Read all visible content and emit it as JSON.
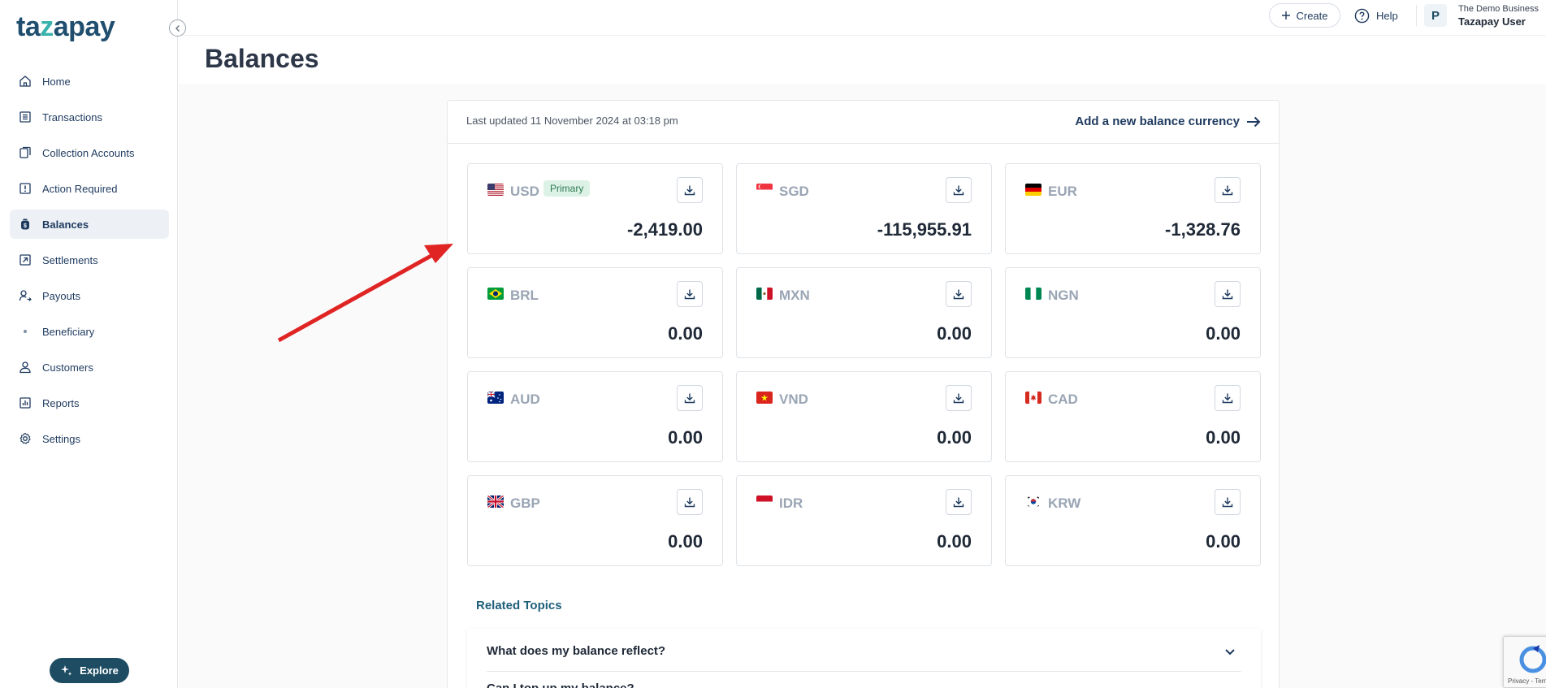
{
  "app": {
    "logo_pre": "ta",
    "logo_z": "z",
    "logo_post": "apay"
  },
  "sidebar": {
    "items": [
      {
        "label": "Home",
        "icon": "home-icon"
      },
      {
        "label": "Transactions",
        "icon": "list-icon"
      },
      {
        "label": "Collection Accounts",
        "icon": "accounts-icon"
      },
      {
        "label": "Action Required",
        "icon": "alert-icon"
      },
      {
        "label": "Balances",
        "icon": "wallet-icon",
        "active": true
      },
      {
        "label": "Settlements",
        "icon": "settlement-icon"
      },
      {
        "label": "Payouts",
        "icon": "payout-icon"
      },
      {
        "label": "Beneficiary",
        "icon": "dot-icon",
        "sub": true
      },
      {
        "label": "Customers",
        "icon": "user-icon"
      },
      {
        "label": "Reports",
        "icon": "chart-icon"
      },
      {
        "label": "Settings",
        "icon": "gear-icon"
      }
    ],
    "explore_label": "Explore"
  },
  "topbar": {
    "create_label": "Create",
    "help_label": "Help",
    "avatar_letter": "P",
    "business_name": "The Demo Business",
    "user_name": "Tazapay User"
  },
  "page": {
    "title": "Balances"
  },
  "panel": {
    "last_updated": "Last updated 11 November 2024 at 03:18 pm",
    "add_currency": "Add a new balance currency",
    "balances": [
      {
        "code": "USD",
        "amount": "-2,419.00",
        "badge": "Primary",
        "flag": "us"
      },
      {
        "code": "SGD",
        "amount": "-115,955.91",
        "flag": "sg"
      },
      {
        "code": "EUR",
        "amount": "-1,328.76",
        "flag": "de"
      },
      {
        "code": "BRL",
        "amount": "0.00",
        "flag": "br"
      },
      {
        "code": "MXN",
        "amount": "0.00",
        "flag": "mx"
      },
      {
        "code": "NGN",
        "amount": "0.00",
        "flag": "ng"
      },
      {
        "code": "AUD",
        "amount": "0.00",
        "flag": "au"
      },
      {
        "code": "VND",
        "amount": "0.00",
        "flag": "vn"
      },
      {
        "code": "CAD",
        "amount": "0.00",
        "flag": "ca"
      },
      {
        "code": "GBP",
        "amount": "0.00",
        "flag": "gb"
      },
      {
        "code": "IDR",
        "amount": "0.00",
        "flag": "id"
      },
      {
        "code": "KRW",
        "amount": "0.00",
        "flag": "kr"
      }
    ],
    "related_topics": "Related Topics",
    "faq": [
      {
        "question": "What does my balance reflect?"
      },
      {
        "question": "Can I top up my balance?"
      }
    ]
  },
  "recaptcha": {
    "text": "Privacy - Terms"
  },
  "colors": {
    "brand": "#1e4d63",
    "accent": "#38b2ac",
    "arrow": "#e02424",
    "primary_badge": "#dcf2e6"
  }
}
